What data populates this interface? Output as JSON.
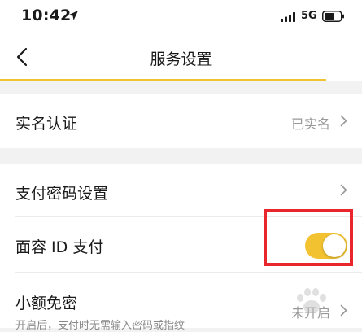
{
  "status_bar": {
    "time": "10:42",
    "network": "5G",
    "icons": [
      "location-arrow-icon",
      "cellular-signal-icon",
      "battery-icon"
    ]
  },
  "header": {
    "title": "服务设置",
    "back_icon": "chevron-left-icon"
  },
  "colors": {
    "accent": "#f2c230",
    "highlight": "#e8262c"
  },
  "sections": {
    "identity": {
      "label": "实名认证",
      "value": "已实名"
    },
    "payment": {
      "password_label": "支付密码设置",
      "faceid_label": "面容 ID 支付",
      "faceid_enabled": true,
      "small_free_label": "小额免密",
      "small_free_subtitle": "开启后，支付时无需输入密码或指纹",
      "small_free_value": "未开启"
    }
  }
}
